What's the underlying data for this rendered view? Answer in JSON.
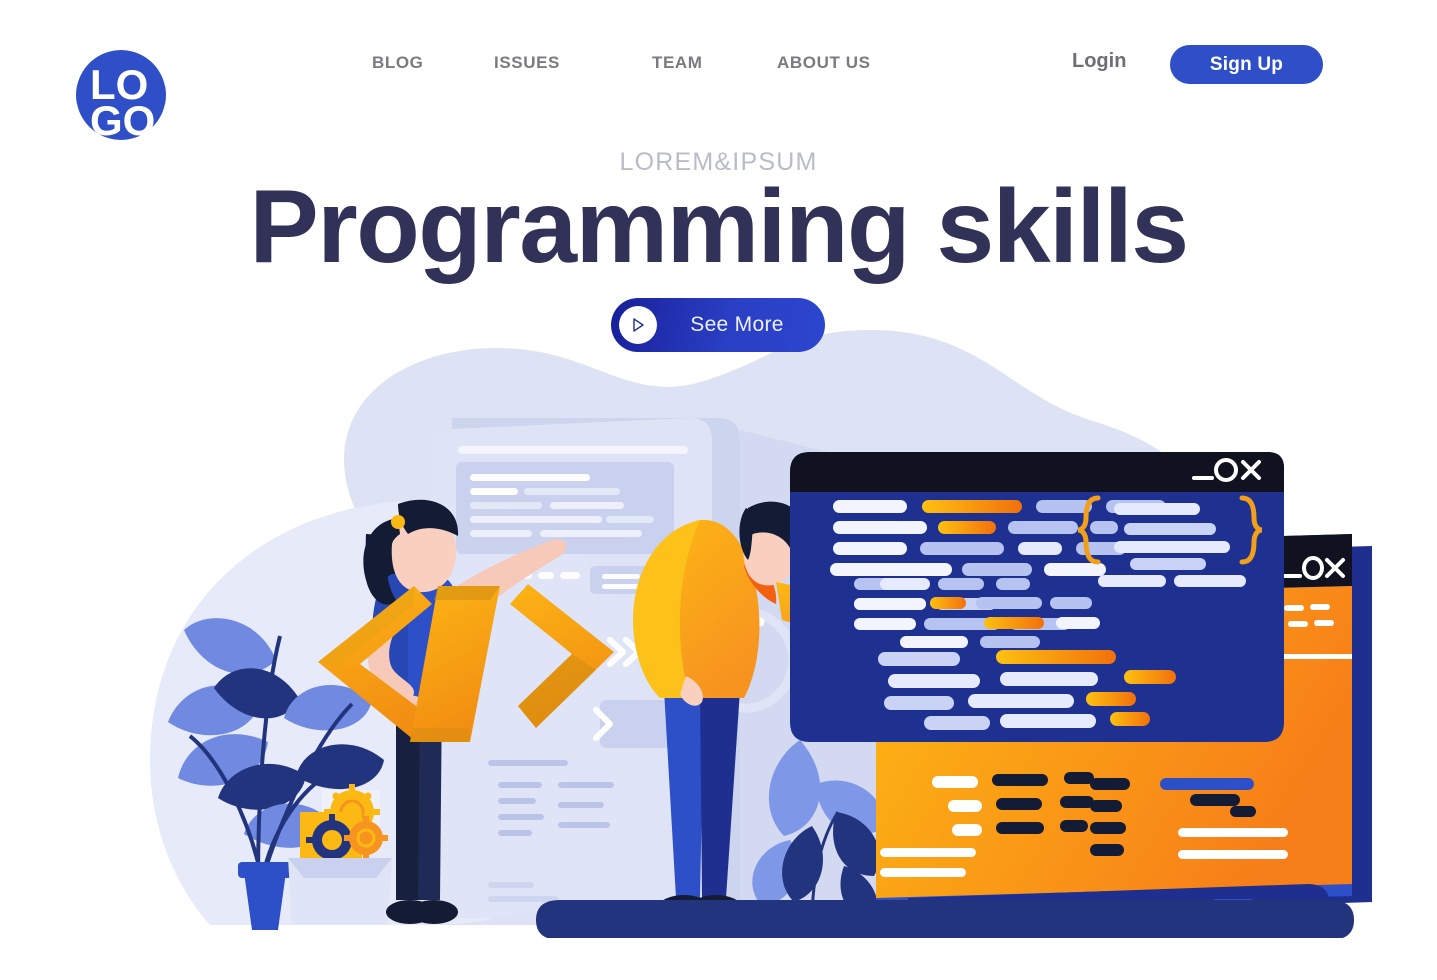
{
  "header": {
    "logo": {
      "text_top": "LO",
      "text_bottom": "GO",
      "icon": "logo-circle-icon",
      "color": "#2e4fc8"
    },
    "nav": [
      {
        "label": "BLOG"
      },
      {
        "label": "ISSUES"
      },
      {
        "label": "TEAM"
      },
      {
        "label": "ABOUT US"
      }
    ],
    "login_label": "Login",
    "signup_label": "Sign Up"
  },
  "hero": {
    "eyebrow": "LOREM&IPSUM",
    "headline": "Programming skills",
    "cta_label": "See More",
    "cta_icon": "play-icon"
  },
  "illustration": {
    "name": "programming-teamwork-illustration",
    "code_window": {
      "title_bar_buttons": [
        "minimize",
        "maximize",
        "close"
      ],
      "brace_open": "{",
      "brace_close": "}"
    },
    "second_window": {
      "title_bar_buttons": [
        "minimize",
        "maximize",
        "close"
      ]
    },
    "code_symbol": "</>",
    "characters": [
      "woman-with-code-symbol",
      "man-pointing-at-screen"
    ],
    "props": [
      "potted-plant",
      "gears-box",
      "leaf-plant",
      "background-tablet"
    ]
  },
  "colors": {
    "brand_blue": "#2e4fc8",
    "deep_navy": "#1a2a7a",
    "headline_navy": "#323259",
    "orange": "#f79420",
    "amber": "#fdb913",
    "light_lavender": "#dde2f5",
    "pale_blue": "#c3cbeb",
    "nav_gray": "#7a7a80",
    "eyebrow_gray": "#b8bcc9",
    "dark_title_bar": "#10131f"
  }
}
